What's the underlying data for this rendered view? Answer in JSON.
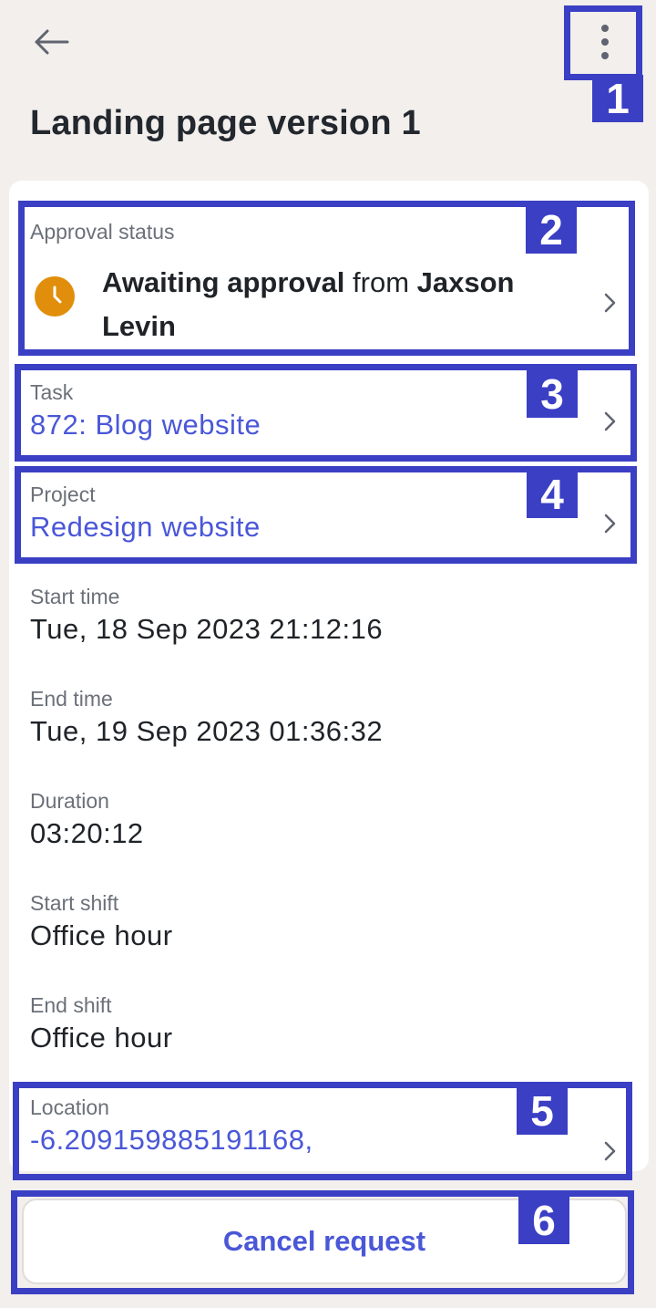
{
  "header": {
    "title": "Landing page version 1",
    "back_icon": "arrow-left-icon",
    "more_icon": "more-vertical-icon"
  },
  "approval": {
    "label": "Approval status",
    "status_bold": "Awaiting approval",
    "from_word": " from ",
    "approver": "Jaxson Levin",
    "icon": "clock-icon",
    "icon_color": "#e08e0b"
  },
  "task": {
    "label": "Task",
    "value": "872: Blog website"
  },
  "project": {
    "label": "Project",
    "value": "Redesign website"
  },
  "details": {
    "start_time_label": "Start time",
    "start_time": "Tue, 18 Sep 2023 21:12:16",
    "end_time_label": "End time",
    "end_time": "Tue, 19 Sep 2023 01:36:32",
    "duration_label": "Duration",
    "duration": "03:20:12",
    "start_shift_label": "Start shift",
    "start_shift": "Office hour",
    "end_shift_label": "End shift",
    "end_shift": "Office hour"
  },
  "location": {
    "label": "Location",
    "value": "-6.209159885191168,"
  },
  "actions": {
    "cancel_label": "Cancel request"
  },
  "markers": [
    "1",
    "2",
    "3",
    "4",
    "5",
    "6"
  ],
  "colors": {
    "accent": "#4a57d8",
    "marker": "#3b3fc4",
    "background": "#f2efec"
  }
}
